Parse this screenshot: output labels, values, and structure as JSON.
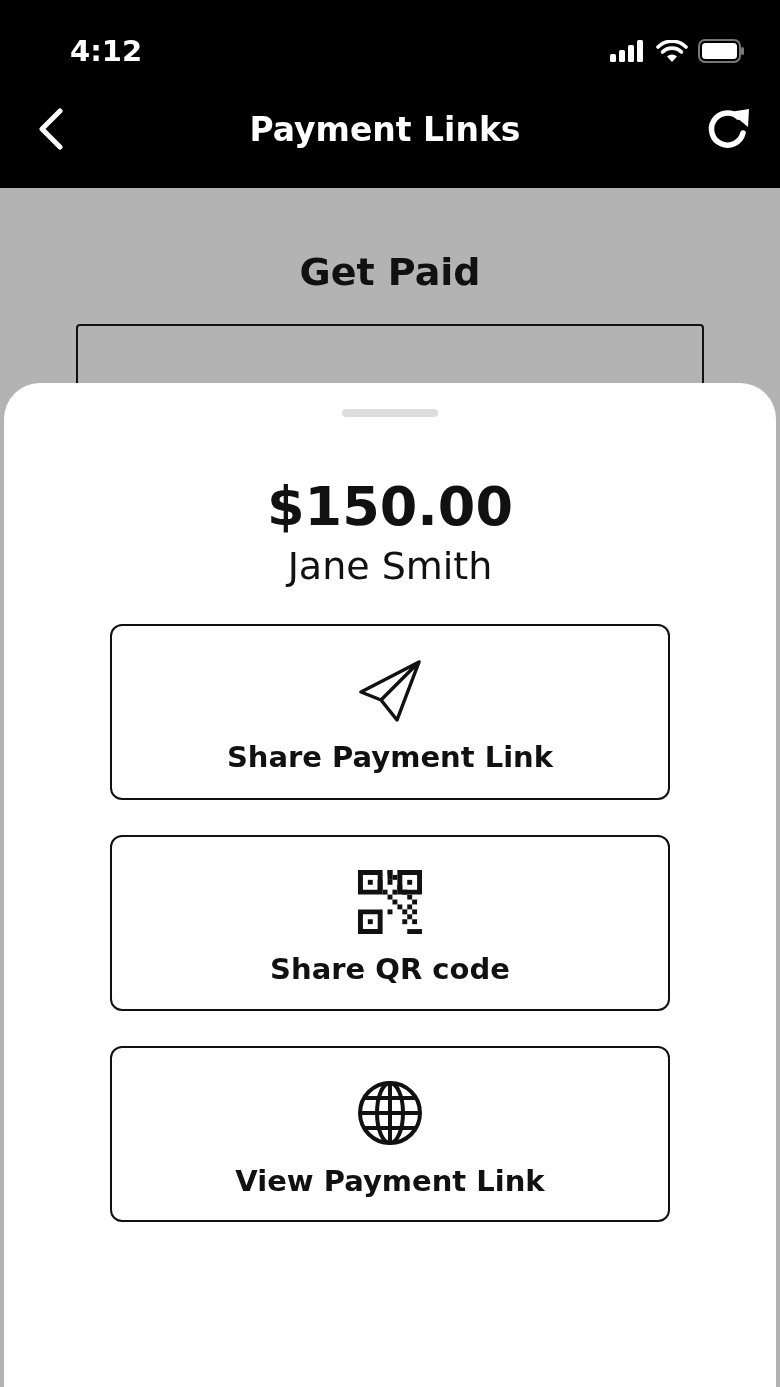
{
  "status_bar": {
    "time": "4:12"
  },
  "header": {
    "title": "Payment Links"
  },
  "background_page": {
    "heading": "Get Paid"
  },
  "sheet": {
    "amount": "$150.00",
    "payer": "Jane Smith",
    "options": [
      {
        "label": "Share Payment Link",
        "kind": "send"
      },
      {
        "label": "Share QR code",
        "kind": "qr"
      },
      {
        "label": "View Payment Link",
        "kind": "web"
      }
    ]
  }
}
